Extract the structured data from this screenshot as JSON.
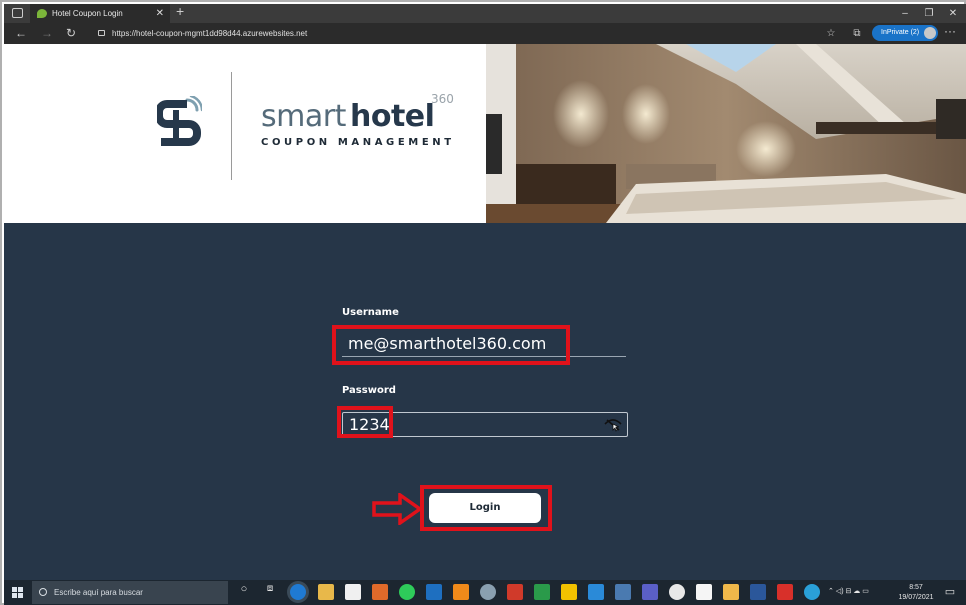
{
  "browser": {
    "tab_title": "Hotel Coupon Login",
    "tab_close": "✕",
    "new_tab": "+",
    "url": "https://hotel-coupon-mgmt1dd98d44.azurewebsites.net",
    "inprivate_label": "InPrivate (2)",
    "more_menu": "···"
  },
  "brand": {
    "name_light": "smart",
    "name_bold": "hotel",
    "superscript": "360",
    "subtitle": "COUPON MANAGEMENT",
    "accent_color": "#26384b"
  },
  "login": {
    "username_label": "Username",
    "username_value": "me@smarthotel360.com",
    "password_label": "Password",
    "password_value": "1234",
    "login_button": "Login",
    "background_color": "#263648",
    "highlight_color": "#e0121b"
  },
  "taskbar": {
    "search_placeholder": "Escribe aquí para buscar",
    "time": "8:57",
    "date": "19/07/2021"
  }
}
